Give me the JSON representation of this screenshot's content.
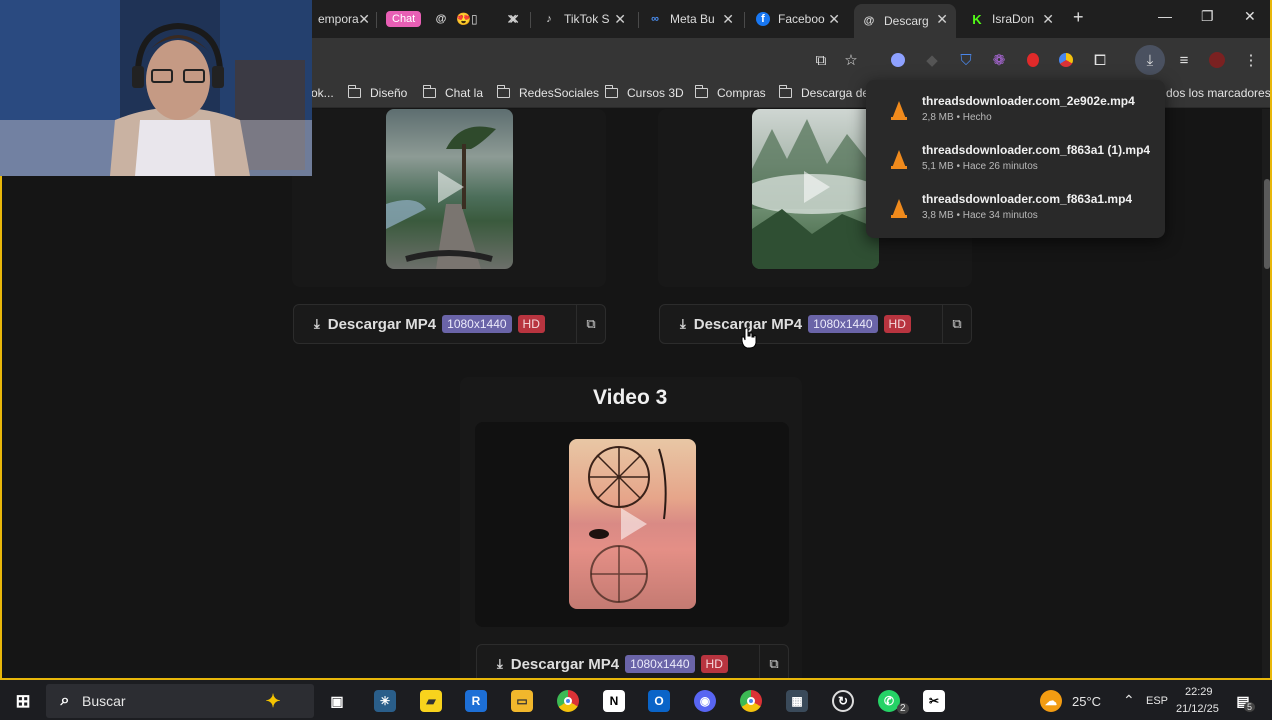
{
  "browser": {
    "tabs": [
      {
        "title": "empora",
        "favicon": "site-icon"
      },
      {
        "title": "Chat",
        "favicon": "chat-pill"
      },
      {
        "title": "😍▯",
        "favicon": "threads-icon"
      },
      {
        "title": "TikTok S",
        "favicon": "tiktok-icon"
      },
      {
        "title": "Meta Bu",
        "favicon": "meta-icon"
      },
      {
        "title": "Faceboo",
        "favicon": "facebook-icon"
      },
      {
        "title": "Descarg",
        "favicon": "threads-icon",
        "active": true
      },
      {
        "title": "IsraDon",
        "favicon": "kick-icon"
      }
    ],
    "new_tab": "+",
    "bookmarks": [
      {
        "label": "ok..."
      },
      {
        "label": "Diseño",
        "folder": true
      },
      {
        "label": "Chat la",
        "folder": true
      },
      {
        "label": "RedesSociales",
        "folder": true
      },
      {
        "label": "Cursos 3D",
        "folder": true
      },
      {
        "label": "Compras",
        "folder": true
      },
      {
        "label": "Descarga de",
        "folder": true
      },
      {
        "label": "dos los marcadores"
      }
    ],
    "downloads": [
      {
        "name": "threadsdownloader.com_2e902e.mp4",
        "meta": "2,8 MB • Hecho"
      },
      {
        "name": "threadsdownloader.com_f863a1 (1).mp4",
        "meta": "5,1 MB • Hace 26 minutos"
      },
      {
        "name": "threadsdownloader.com_f863a1.mp4",
        "meta": "3,8 MB • Hace 34 minutos"
      }
    ]
  },
  "page": {
    "videos": [
      {
        "download_label": "Descargar MP4",
        "resolution": "1080x1440",
        "quality": "HD"
      },
      {
        "download_label": "Descargar MP4",
        "resolution": "1080x1440",
        "quality": "HD"
      },
      {
        "title": "Video 3",
        "download_label": "Descargar MP4",
        "resolution": "1080x1440",
        "quality": "HD"
      }
    ]
  },
  "taskbar": {
    "search_label": "Buscar",
    "weather": "25°C",
    "language": "ESP",
    "time": "22:29",
    "date": "21/12/25",
    "notifications": "5",
    "whatsapp_badge": "2"
  },
  "colors": {
    "resolution_badge": "#6a64a8",
    "hd_badge": "#b8343f",
    "frame": "#e8b70a",
    "vlc_cone": "#f08a1c"
  }
}
